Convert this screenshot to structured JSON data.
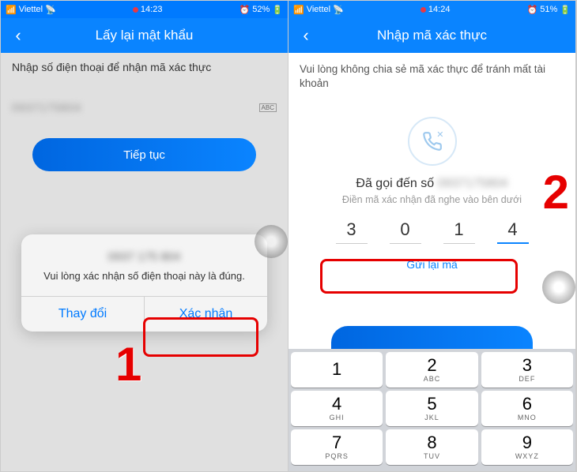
{
  "left": {
    "status": {
      "carrier": "Viettel",
      "time": "14:23",
      "battery": "52%"
    },
    "nav_title": "Lấy lại mật khẩu",
    "instruction": "Nhập số điện thoại để nhận mã xác thực",
    "phone_placeholder": "",
    "continue_label": "Tiếp tục",
    "alert": {
      "message": "Vui lòng xác nhận số điện thoại này là đúng.",
      "change": "Thay đổi",
      "confirm": "Xác nhận"
    },
    "step": "1"
  },
  "right": {
    "status": {
      "carrier": "Viettel",
      "time": "14:24",
      "battery": "51%"
    },
    "nav_title": "Nhập mã xác thực",
    "instruction": "Vui lòng không chia sẻ mã xác thực để tránh mất tài khoản",
    "called_prefix": "Đã gọi đến số",
    "sub_instruction": "Điền mã xác nhận đã nghe vào bên dưới",
    "code": [
      "3",
      "0",
      "1",
      "4"
    ],
    "resend": "Gửi lại mã",
    "step": "2",
    "keypad": [
      [
        {
          "n": "1",
          "l": ""
        },
        {
          "n": "2",
          "l": "ABC"
        },
        {
          "n": "3",
          "l": "DEF"
        }
      ],
      [
        {
          "n": "4",
          "l": "GHI"
        },
        {
          "n": "5",
          "l": "JKL"
        },
        {
          "n": "6",
          "l": "MNO"
        }
      ],
      [
        {
          "n": "7",
          "l": "PQRS"
        },
        {
          "n": "8",
          "l": "TUV"
        },
        {
          "n": "9",
          "l": "WXYZ"
        }
      ]
    ]
  }
}
